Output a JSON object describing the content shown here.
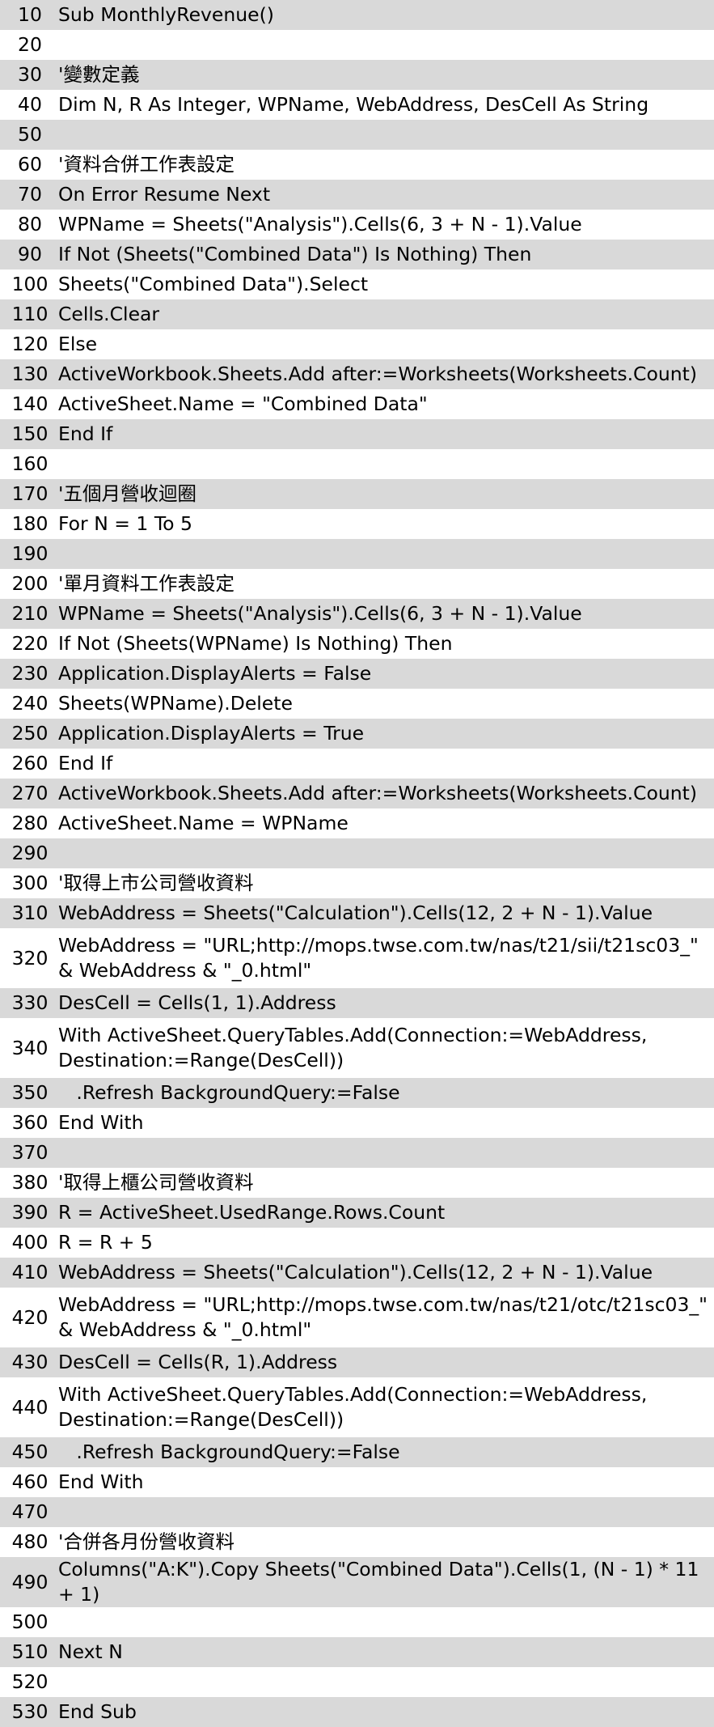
{
  "lines": [
    {
      "num": "10",
      "code": "Sub MonthlyRevenue()"
    },
    {
      "num": "20",
      "code": ""
    },
    {
      "num": "30",
      "code": "'變數定義"
    },
    {
      "num": "40",
      "code": "Dim N, R As Integer, WPName, WebAddress, DesCell As String"
    },
    {
      "num": "50",
      "code": ""
    },
    {
      "num": "60",
      "code": "'資料合併工作表設定"
    },
    {
      "num": "70",
      "code": "On Error Resume Next"
    },
    {
      "num": "80",
      "code": "WPName = Sheets(\"Analysis\").Cells(6, 3 + N - 1).Value"
    },
    {
      "num": "90",
      "code": "If Not (Sheets(\"Combined Data\") Is Nothing) Then"
    },
    {
      "num": "100",
      "code": "Sheets(\"Combined Data\").Select"
    },
    {
      "num": "110",
      "code": "Cells.Clear"
    },
    {
      "num": "120",
      "code": "Else"
    },
    {
      "num": "130",
      "code": "ActiveWorkbook.Sheets.Add after:=Worksheets(Worksheets.Count)"
    },
    {
      "num": "140",
      "code": "ActiveSheet.Name = \"Combined Data\""
    },
    {
      "num": "150",
      "code": "End If"
    },
    {
      "num": "160",
      "code": ""
    },
    {
      "num": "170",
      "code": "'五個月營收迴圈"
    },
    {
      "num": "180",
      "code": "For N = 1 To 5"
    },
    {
      "num": "190",
      "code": ""
    },
    {
      "num": "200",
      "code": "'單月資料工作表設定"
    },
    {
      "num": "210",
      "code": "WPName = Sheets(\"Analysis\").Cells(6, 3 + N - 1).Value"
    },
    {
      "num": "220",
      "code": "If Not (Sheets(WPName) Is Nothing) Then"
    },
    {
      "num": "230",
      "code": "Application.DisplayAlerts = False"
    },
    {
      "num": "240",
      "code": "Sheets(WPName).Delete"
    },
    {
      "num": "250",
      "code": "Application.DisplayAlerts = True"
    },
    {
      "num": "260",
      "code": "End If"
    },
    {
      "num": "270",
      "code": "ActiveWorkbook.Sheets.Add after:=Worksheets(Worksheets.Count)"
    },
    {
      "num": "280",
      "code": "ActiveSheet.Name = WPName"
    },
    {
      "num": "290",
      "code": ""
    },
    {
      "num": "300",
      "code": "'取得上市公司營收資料"
    },
    {
      "num": "310",
      "code": "WebAddress = Sheets(\"Calculation\").Cells(12, 2 + N - 1).Value"
    },
    {
      "num": "320",
      "code": "WebAddress = \"URL;http://mops.twse.com.tw/nas/t21/sii/t21sc03_\" & WebAddress & \"_0.html\""
    },
    {
      "num": "330",
      "code": "DesCell = Cells(1, 1).Address"
    },
    {
      "num": "340",
      "code": "With ActiveSheet.QueryTables.Add(Connection:=WebAddress, Destination:=Range(DesCell))"
    },
    {
      "num": "350",
      "code": "   .Refresh BackgroundQuery:=False"
    },
    {
      "num": "360",
      "code": "End With"
    },
    {
      "num": "370",
      "code": ""
    },
    {
      "num": "380",
      "code": "'取得上櫃公司營收資料"
    },
    {
      "num": "390",
      "code": "R = ActiveSheet.UsedRange.Rows.Count"
    },
    {
      "num": "400",
      "code": "R = R + 5"
    },
    {
      "num": "410",
      "code": "WebAddress = Sheets(\"Calculation\").Cells(12, 2 + N - 1).Value"
    },
    {
      "num": "420",
      "code": "WebAddress = \"URL;http://mops.twse.com.tw/nas/t21/otc/t21sc03_\" & WebAddress & \"_0.html\""
    },
    {
      "num": "430",
      "code": "DesCell = Cells(R, 1).Address"
    },
    {
      "num": "440",
      "code": "With ActiveSheet.QueryTables.Add(Connection:=WebAddress, Destination:=Range(DesCell))"
    },
    {
      "num": "450",
      "code": "   .Refresh BackgroundQuery:=False"
    },
    {
      "num": "460",
      "code": "End With"
    },
    {
      "num": "470",
      "code": ""
    },
    {
      "num": "480",
      "code": "'合併各月份營收資料"
    },
    {
      "num": "490",
      "code": "Columns(\"A:K\").Copy Sheets(\"Combined Data\").Cells(1, (N - 1) * 11 + 1)"
    },
    {
      "num": "500",
      "code": ""
    },
    {
      "num": "510",
      "code": "Next N"
    },
    {
      "num": "520",
      "code": ""
    },
    {
      "num": "530",
      "code": "End Sub"
    }
  ],
  "colors": {
    "row_shaded": "#d9d9d9",
    "row_plain": "#ffffff",
    "text": "#000000"
  }
}
